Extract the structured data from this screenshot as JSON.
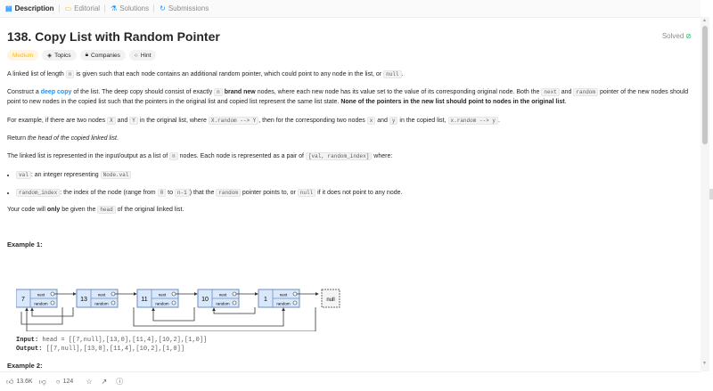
{
  "tabs": [
    {
      "label": "Description",
      "icon": "description-icon",
      "glyph": "▤"
    },
    {
      "label": "Editorial",
      "icon": "editorial-icon",
      "glyph": "▭"
    },
    {
      "label": "Solutions",
      "icon": "solutions-icon",
      "glyph": "⚗"
    },
    {
      "label": "Submissions",
      "icon": "submissions-icon",
      "glyph": "↻"
    }
  ],
  "problem": {
    "title": "138. Copy List with Random Pointer",
    "status": "Solved",
    "difficulty": "Medium",
    "tags": [
      "Topics",
      "Companies",
      "Hint"
    ]
  },
  "description": {
    "p1a": "A linked list of length ",
    "p1_n": "n",
    "p1b": " is given such that each node contains an additional random pointer, which could point to any node in the list, or ",
    "p1_null": "null",
    "p1c": ".",
    "p2a": "Construct a ",
    "p2_deep": "deep copy",
    "p2b": " of the list. The deep copy should consist of exactly ",
    "p2_n": "n",
    "p2_brand": "brand new",
    "p2c": " nodes, where each new node has its value set to the value of its corresponding original node. Both the ",
    "p2_next": "next",
    "p2_and": " and ",
    "p2_random": "random",
    "p2d": " pointer of the new nodes should point to new nodes in the copied list such that the pointers in the original list and copied list represent the same list state. ",
    "p2_bold": "None of the pointers in the new list should point to nodes in the original list",
    "p2e": ".",
    "p3a": "For example, if there are two nodes ",
    "p3_X": "X",
    "p3_and": " and ",
    "p3_Y": "Y",
    "p3b": " in the original list, where ",
    "p3_xr": "X.random --> Y",
    "p3c": ", then for the corresponding two nodes ",
    "p3_x": "x",
    "p3_and2": " and ",
    "p3_y": "y",
    "p3d": " in the copied list, ",
    "p3_xr2": "x.random --> y",
    "p3e": ".",
    "p4a": "Return ",
    "p4_it": "the head of the copied linked list",
    "p4b": ".",
    "p5a": "The linked list is represented in the input/output as a list of ",
    "p5_n": "n",
    "p5b": " nodes. Each node is represented as a pair of ",
    "p5_pair": "[val, random_index]",
    "p5c": " where:",
    "li1_code": "val",
    "li1a": ": an integer representing ",
    "li1_code2": "Node.val",
    "li2_code": "random_index",
    "li2a": ": the index of the node (range from ",
    "li2_0": "0",
    "li2_to": " to ",
    "li2_n1": "n-1",
    "li2b": ") that the ",
    "li2_random": "random",
    "li2c": " pointer points to, or ",
    "li2_null": "null",
    "li2d": " if it does not point to any node.",
    "p6a": "Your code will ",
    "p6_only": "only",
    "p6b": " be given the ",
    "p6_head": "head",
    "p6c": " of the original linked list."
  },
  "example1": {
    "heading": "Example 1:",
    "nodes": [
      "7",
      "13",
      "11",
      "10",
      "1"
    ],
    "null_label": "null",
    "next_label": "next",
    "random_label": "random",
    "input_label": "Input:",
    "input_value": "head = [[7,null],[13,0],[11,4],[10,2],[1,0]]",
    "output_label": "Output:",
    "output_value": "[[7,null],[13,0],[11,4],[10,2],[1,0]]"
  },
  "example2": {
    "heading": "Example 2:"
  },
  "footer": {
    "likes": "13.6K",
    "comments": "124"
  },
  "colors": {
    "accent": "#1a90ff",
    "medium": "#ffb800",
    "solved": "#2cbb5d",
    "node_fill": "#dae8fc",
    "node_stroke": "#6c8ebf"
  }
}
